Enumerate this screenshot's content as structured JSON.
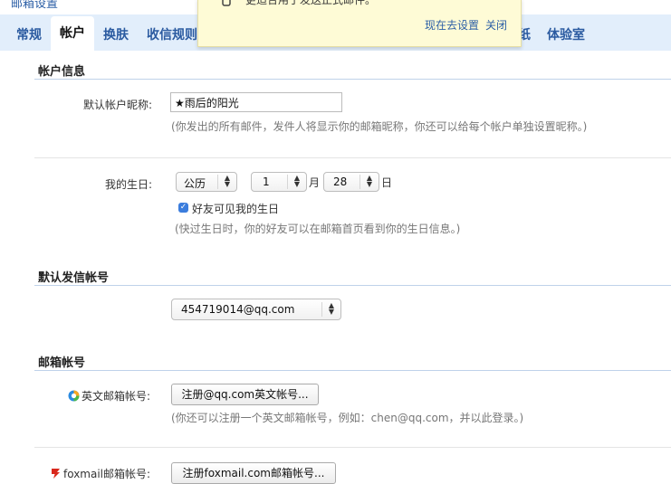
{
  "header": {
    "title": "邮箱设置"
  },
  "tabs": [
    {
      "label": "常规"
    },
    {
      "label": "帐户"
    },
    {
      "label": "换肤"
    },
    {
      "label": "收信规则"
    },
    {
      "label": "纸"
    },
    {
      "label": "体验室"
    }
  ],
  "popup": {
    "message": "更适合用于发送正式邮件。",
    "setup_now": "现在去设置",
    "close": "关闭"
  },
  "account_info": {
    "title": "帐户信息",
    "nickname_label": "默认帐户昵称:",
    "nickname_value": "★雨后的阳光",
    "nickname_hint": "(你发出的所有邮件，发件人将显示你的邮箱昵称，你还可以给每个帐户单独设置昵称。)",
    "birthday_label": "我的生日:",
    "calendar_value": "公历",
    "month_value": "1",
    "month_unit": "月",
    "day_value": "28",
    "day_unit": "日",
    "friends_see_label": "好友可见我的生日",
    "friends_see_checked": true,
    "birthday_hint": "(快过生日时，你的好友可以在邮箱首页看到你的生日信息。)"
  },
  "default_sender": {
    "title": "默认发信帐号",
    "value": "454719014@qq.com"
  },
  "mailbox_accounts": {
    "title": "邮箱帐号",
    "english_label": "英文邮箱帐号:",
    "english_button": "注册@qq.com英文帐号...",
    "english_hint": "(你还可以注册一个英文邮箱帐号，例如：chen@qq.com，并以此登录。)",
    "foxmail_label": "foxmail邮箱帐号:",
    "foxmail_button": "注册foxmail.com邮箱帐号..."
  },
  "colors": {
    "accent": "#2a5aa0",
    "tab_bar": "#e2eefb",
    "popup_bg": "#fefbd6",
    "underline_mark": "#1a9be0",
    "checkbox": "#3b7ddd"
  }
}
